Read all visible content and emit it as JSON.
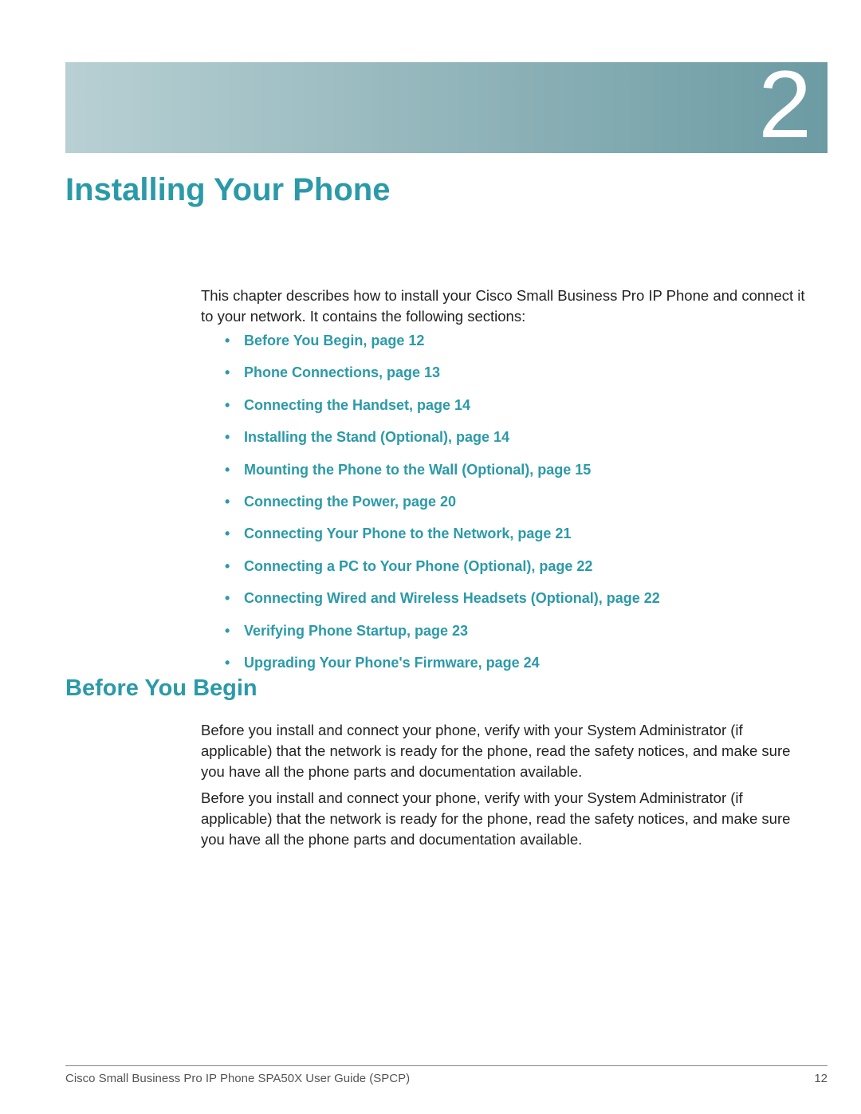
{
  "chapter_number": "2",
  "chapter_title": "Installing Your Phone",
  "intro": "This chapter describes how to install your Cisco Small Business Pro IP Phone and connect it to your network. It contains the following sections:",
  "toc": [
    "Before You Begin, page 12",
    "Phone Connections, page 13",
    "Connecting the Handset, page 14",
    "Installing the Stand (Optional), page 14",
    "Mounting the Phone to the Wall (Optional), page 15",
    "Connecting the Power, page 20",
    "Connecting Your Phone to the Network, page 21",
    "Connecting a PC to Your Phone (Optional), page 22",
    "Connecting Wired and Wireless Headsets (Optional), page 22",
    "Verifying Phone Startup, page 23",
    "Upgrading Your Phone's Firmware, page 24"
  ],
  "section_heading": "Before You Begin",
  "body_p1": "Before you install and connect your phone, verify with your System Administrator (if applicable) that the network is ready for the phone, read the safety notices, and make sure you have all the phone parts and documentation available.",
  "body_p2": "Before you install and connect your phone, verify with your System Administrator (if applicable) that the network is ready for the phone, read the safety notices, and make sure you have all the phone parts and documentation available.",
  "footer_doc": "Cisco Small Business Pro IP Phone SPA50X User Guide (SPCP)",
  "footer_page": "12"
}
